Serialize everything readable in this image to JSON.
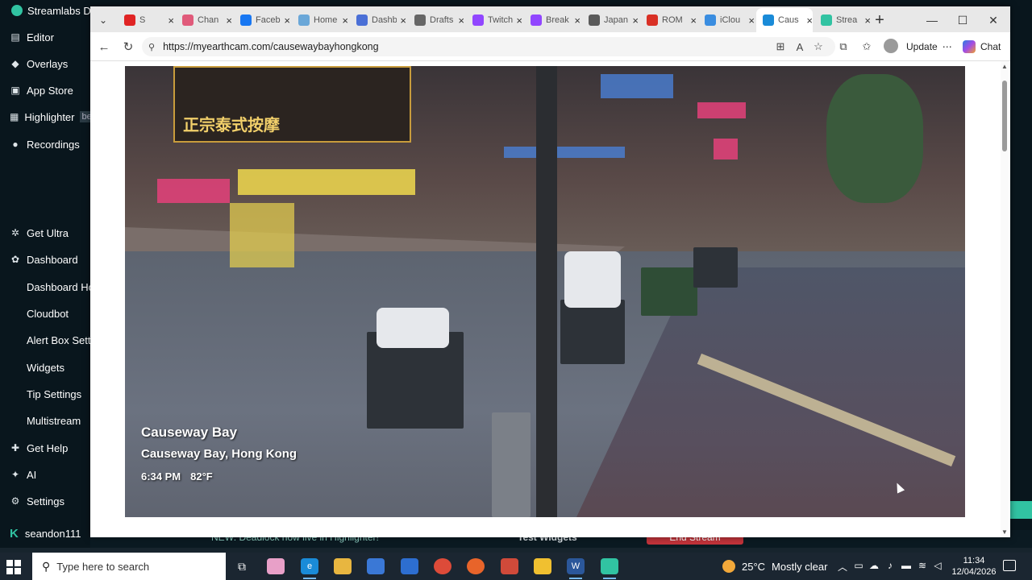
{
  "streamlabs": {
    "title": "Streamlabs De",
    "nav": [
      {
        "label": "Editor",
        "icon": "editor-icon"
      },
      {
        "label": "Overlays",
        "icon": "overlays-icon"
      },
      {
        "label": "App Store",
        "icon": "app-store-icon"
      },
      {
        "label": "Highlighter",
        "badge": "be",
        "icon": "highlighter-icon"
      },
      {
        "label": "Recordings",
        "icon": "recordings-icon"
      },
      {
        "label": "Get Ultra",
        "icon": "ultra-icon"
      },
      {
        "label": "Dashboard",
        "icon": "dashboard-icon"
      },
      {
        "label": "Dashboard Hor"
      },
      {
        "label": "Cloudbot"
      },
      {
        "label": "Alert Box Settin"
      },
      {
        "label": "Widgets"
      },
      {
        "label": "Tip Settings"
      },
      {
        "label": "Multistream"
      },
      {
        "label": "Get Help",
        "icon": "help-icon"
      },
      {
        "label": "AI",
        "icon": "ai-icon"
      },
      {
        "label": "Settings",
        "icon": "settings-icon"
      }
    ],
    "user": "seandon111",
    "footer_news": "NEW: Deadlock now live in Highlighter!",
    "footer_test": "Test Widgets",
    "footer_end": "End Stream",
    "accent": "#31c3a2"
  },
  "browser": {
    "tabs": [
      {
        "label": "S",
        "favicon_color": "#e02424",
        "favicon": "youtube-icon"
      },
      {
        "label": "Chan",
        "favicon_color": "#e05a7a",
        "favicon": "channel-icon"
      },
      {
        "label": "Faceb",
        "favicon_color": "#1877f2",
        "favicon": "facebook-icon"
      },
      {
        "label": "Home",
        "favicon_color": "#6aa7d8",
        "favicon": "home-icon"
      },
      {
        "label": "Dashb",
        "favicon_color": "#4a6fd6",
        "favicon": "dashboard-icon"
      },
      {
        "label": "Drafts",
        "favicon_color": "#666666",
        "favicon": "drafts-icon"
      },
      {
        "label": "Twitch",
        "favicon_color": "#9146ff",
        "favicon": "twitch-icon"
      },
      {
        "label": "Break",
        "favicon_color": "#9146ff",
        "favicon": "twitch-icon"
      },
      {
        "label": "Japan",
        "favicon_color": "#5a5a5a",
        "favicon": "search-icon"
      },
      {
        "label": "ROM",
        "favicon_color": "#d93025",
        "favicon": "gmail-icon"
      },
      {
        "label": "iClou",
        "favicon_color": "#3a8de0",
        "favicon": "icloud-icon"
      },
      {
        "label": "Caus",
        "favicon_color": "#1a8bd8",
        "favicon": "edge-icon",
        "active": true
      },
      {
        "label": "Strea",
        "favicon_color": "#31c3a2",
        "favicon": "streamlabs-icon"
      }
    ],
    "url": "https://myearthcam.com/causewaybayhongkong",
    "update_label": "Update",
    "chat_label": "Chat"
  },
  "cam": {
    "title": "Causeway Bay",
    "location": "Causeway Bay, Hong Kong",
    "time": "6:34 PM",
    "temp": "82°F"
  },
  "taskbar": {
    "search_placeholder": "Type here to search",
    "weather_temp": "25°C",
    "weather_cond": "Mostly clear",
    "time": "11:34",
    "date": "12/04/2026"
  }
}
